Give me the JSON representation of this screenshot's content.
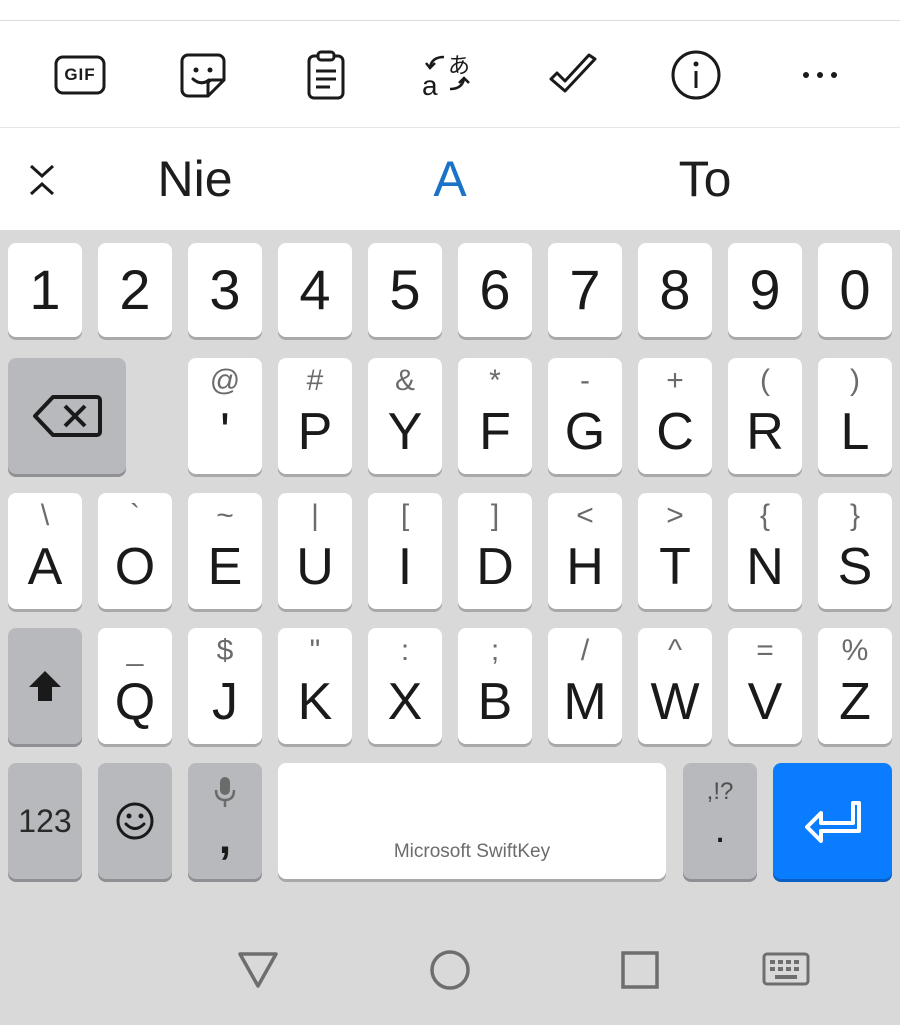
{
  "toolbar": {
    "icons": [
      "gif-icon",
      "sticker-icon",
      "clipboard-icon",
      "translate-icon",
      "checkmark-icon",
      "info-icon",
      "more-icon"
    ],
    "gif_label": "GIF"
  },
  "suggestions": {
    "left": "Nie",
    "middle": "A",
    "right": "To",
    "accent_color": "#1a73c8"
  },
  "keyboard": {
    "numbers": [
      "1",
      "2",
      "3",
      "4",
      "5",
      "6",
      "7",
      "8",
      "9",
      "0"
    ],
    "row1": [
      {
        "sec": "@",
        "pri": "'"
      },
      {
        "sec": "#",
        "pri": "P"
      },
      {
        "sec": "&",
        "pri": "Y"
      },
      {
        "sec": "*",
        "pri": "F"
      },
      {
        "sec": "-",
        "pri": "G"
      },
      {
        "sec": "+",
        "pri": "C"
      },
      {
        "sec": "(",
        "pri": "R"
      },
      {
        "sec": ")",
        "pri": "L"
      }
    ],
    "row2": [
      {
        "sec": "\\",
        "pri": "A"
      },
      {
        "sec": "`",
        "pri": "O"
      },
      {
        "sec": "~",
        "pri": "E"
      },
      {
        "sec": "|",
        "pri": "U"
      },
      {
        "sec": "[",
        "pri": "I"
      },
      {
        "sec": "]",
        "pri": "D"
      },
      {
        "sec": "<",
        "pri": "H"
      },
      {
        "sec": ">",
        "pri": "T"
      },
      {
        "sec": "{",
        "pri": "N"
      },
      {
        "sec": "}",
        "pri": "S"
      }
    ],
    "row3": [
      {
        "sec": "_",
        "pri": "Q"
      },
      {
        "sec": "$",
        "pri": "J"
      },
      {
        "sec": "\"",
        "pri": "K"
      },
      {
        "sec": ":",
        "pri": "X"
      },
      {
        "sec": ";",
        "pri": "B"
      },
      {
        "sec": "/",
        "pri": "M"
      },
      {
        "sec": "^",
        "pri": "W"
      },
      {
        "sec": "=",
        "pri": "V"
      },
      {
        "sec": "%",
        "pri": "Z"
      }
    ],
    "bottom": {
      "numbers_key": "123",
      "comma_key": ",",
      "space_label": "Microsoft SwiftKey",
      "punct_top": ",!?",
      "punct_main": "."
    },
    "accent_color": "#0a7cff"
  },
  "navbar": {
    "icons": [
      "back-triangle-icon",
      "home-circle-icon",
      "recents-square-icon",
      "keyboard-icon"
    ]
  }
}
